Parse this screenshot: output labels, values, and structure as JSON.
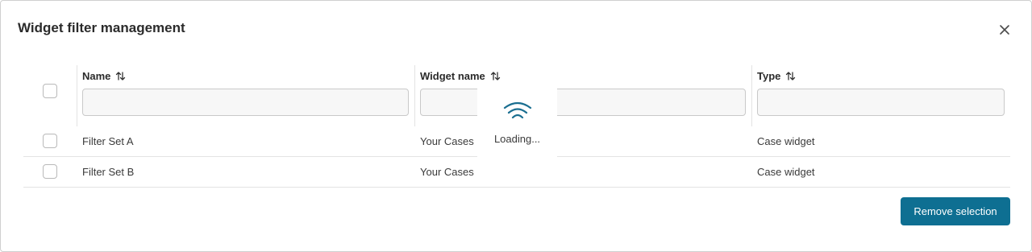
{
  "dialog": {
    "title": "Widget filter management",
    "close_icon": "close-icon"
  },
  "table": {
    "columns": [
      {
        "label": "Name",
        "sort_icon": "sort-icon",
        "filter_value": ""
      },
      {
        "label": "Widget name",
        "sort_icon": "sort-icon",
        "filter_value": ""
      },
      {
        "label": "Type",
        "sort_icon": "sort-icon",
        "filter_value": ""
      }
    ],
    "rows": [
      {
        "checked": false,
        "name": "Filter Set A",
        "widget_name": "Your Cases",
        "type": "Case widget"
      },
      {
        "checked": false,
        "name": "Filter Set B",
        "widget_name": "Your Cases",
        "type": "Case widget"
      }
    ]
  },
  "loading": {
    "text": "Loading...",
    "icon": "wifi-signal-icon"
  },
  "footer": {
    "remove_label": "Remove selection"
  },
  "colors": {
    "primary": "#0e6f92",
    "loader_icon": "#1a6e90"
  }
}
